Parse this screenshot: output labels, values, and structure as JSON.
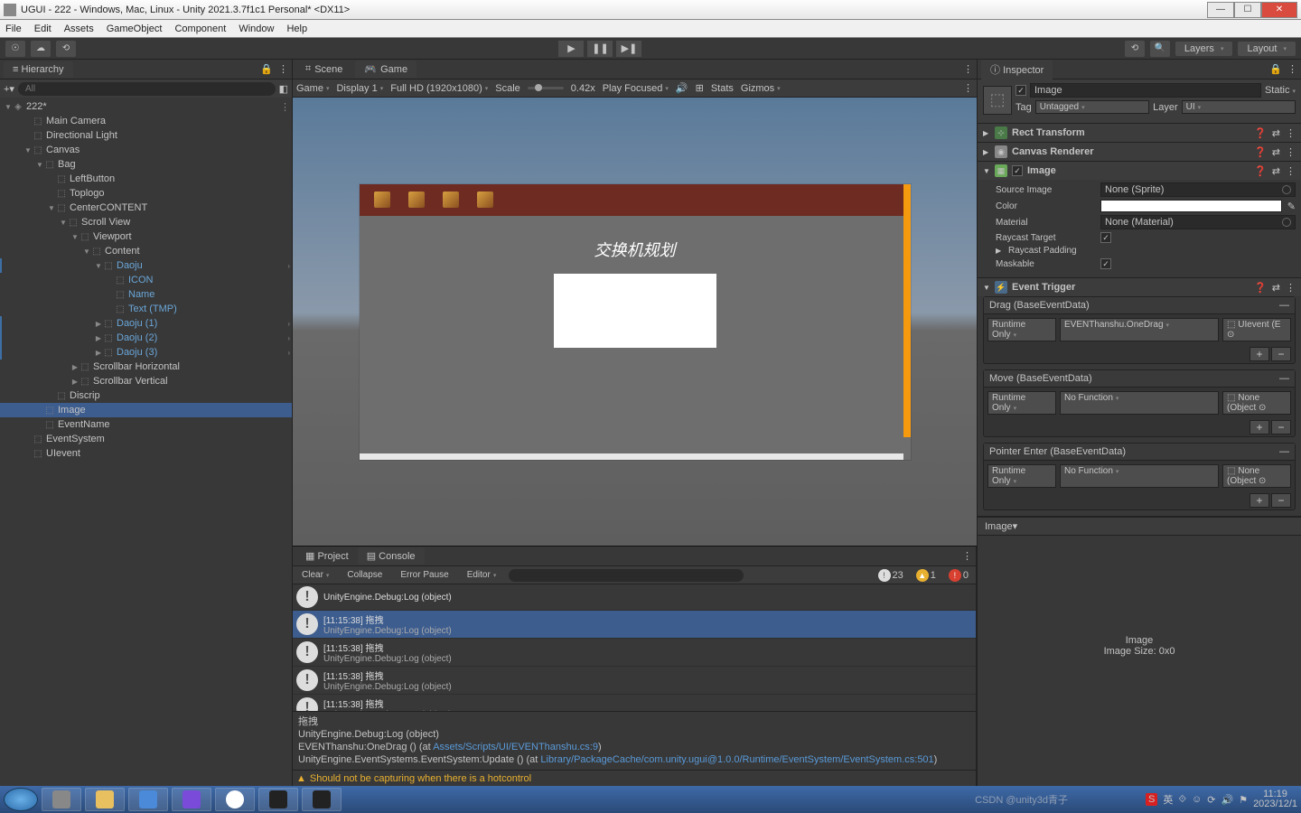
{
  "titlebar": {
    "text": "UGUI - 222 - Windows, Mac, Linux - Unity 2021.3.7f1c1 Personal* <DX11>"
  },
  "menubar": [
    "File",
    "Edit",
    "Assets",
    "GameObject",
    "Component",
    "Window",
    "Help"
  ],
  "toolbar": {
    "layers": "Layers",
    "layout": "Layout"
  },
  "hierarchy": {
    "title": "Hierarchy",
    "search_placeholder": "All",
    "root": "222*",
    "items": [
      {
        "label": "Main Camera",
        "indent": 2
      },
      {
        "label": "Directional Light",
        "indent": 2
      },
      {
        "label": "Canvas",
        "indent": 2,
        "arrow": "▼"
      },
      {
        "label": "Bag",
        "indent": 3,
        "arrow": "▼"
      },
      {
        "label": "LeftButton",
        "indent": 4
      },
      {
        "label": "Toplogo",
        "indent": 4
      },
      {
        "label": "CenterCONTENT",
        "indent": 4,
        "arrow": "▼"
      },
      {
        "label": "Scroll View",
        "indent": 5,
        "arrow": "▼"
      },
      {
        "label": "Viewport",
        "indent": 6,
        "arrow": "▼"
      },
      {
        "label": "Content",
        "indent": 7,
        "arrow": "▼"
      },
      {
        "label": "Daoju",
        "indent": 8,
        "arrow": "▼",
        "blue": true,
        "blueline": true,
        "more": true
      },
      {
        "label": "ICON",
        "indent": 9,
        "blue": true
      },
      {
        "label": "Name",
        "indent": 9,
        "blue": true
      },
      {
        "label": "Text (TMP)",
        "indent": 9,
        "blue": true
      },
      {
        "label": "Daoju (1)",
        "indent": 8,
        "arrow": "▶",
        "blue": true,
        "blueline": true,
        "more": true
      },
      {
        "label": "Daoju (2)",
        "indent": 8,
        "arrow": "▶",
        "blue": true,
        "blueline": true,
        "more": true
      },
      {
        "label": "Daoju (3)",
        "indent": 8,
        "arrow": "▶",
        "blue": true,
        "blueline": true,
        "more": true
      },
      {
        "label": "Scrollbar Horizontal",
        "indent": 6,
        "arrow": "▶"
      },
      {
        "label": "Scrollbar Vertical",
        "indent": 6,
        "arrow": "▶"
      },
      {
        "label": "Discrip",
        "indent": 4
      },
      {
        "label": "Image",
        "indent": 3,
        "selected": true
      },
      {
        "label": "EventName",
        "indent": 3
      },
      {
        "label": "EventSystem",
        "indent": 2
      },
      {
        "label": "UIevent",
        "indent": 2
      }
    ]
  },
  "viewtabs": {
    "scene": "Scene",
    "game": "Game"
  },
  "viewtoolbar": {
    "game": "Game",
    "display": "Display 1",
    "res": "Full HD (1920x1080)",
    "scale": "Scale",
    "scale_val": "0.42x",
    "play": "Play Focused",
    "stats": "Stats",
    "gizmos": "Gizmos"
  },
  "gameview": {
    "title": "交换机规划"
  },
  "inspector": {
    "title": "Inspector",
    "name": "Image",
    "static": "Static",
    "tag_label": "Tag",
    "tag": "Untagged",
    "layer_label": "Layer",
    "layer": "UI",
    "components": {
      "rect": "Rect Transform",
      "canvas": "Canvas Renderer",
      "image": "Image",
      "image_fields": {
        "source_image": "Source Image",
        "source_image_val": "None (Sprite)",
        "color": "Color",
        "material": "Material",
        "material_val": "None (Material)",
        "raycast": "Raycast Target",
        "raycast_pad": "Raycast Padding",
        "maskable": "Maskable"
      },
      "event_trigger": "Event Trigger",
      "events": [
        {
          "name": "Drag (BaseEventData)",
          "mode": "Runtime Only",
          "func": "EVENThanshu.OneDrag",
          "obj": "UIevent (E"
        },
        {
          "name": "Move (BaseEventData)",
          "mode": "Runtime Only",
          "func": "No Function",
          "obj": "None (Object"
        },
        {
          "name": "Pointer Enter (BaseEventData)",
          "mode": "Runtime Only",
          "func": "No Function",
          "obj": "None (Object"
        }
      ]
    },
    "footer_name": "Image",
    "footer_size": "Image Size: 0x0",
    "image_strip": "Image"
  },
  "bottom": {
    "project": "Project",
    "console": "Console",
    "toolbar": {
      "clear": "Clear",
      "collapse": "Collapse",
      "errpause": "Error Pause",
      "editor": "Editor"
    },
    "counts": {
      "info": "23",
      "warn": "1",
      "err": "0"
    },
    "logs": [
      {
        "line1": "UnityEngine.Debug:Log (object)",
        "line2": "",
        "single": true
      },
      {
        "line1": "[11:15:38] 拖拽",
        "line2": "UnityEngine.Debug:Log (object)",
        "sel": true
      },
      {
        "line1": "[11:15:38] 拖拽",
        "line2": "UnityEngine.Debug:Log (object)"
      },
      {
        "line1": "[11:15:38] 拖拽",
        "line2": "UnityEngine.Debug:Log (object)"
      },
      {
        "line1": "[11:15:38] 拖拽",
        "line2": "UnityEngine.Debug:Log (object)"
      }
    ],
    "detail": {
      "l1": "拖拽",
      "l2": "UnityEngine.Debug:Log (object)",
      "l3a": "EVENThanshu:OneDrag () (at ",
      "l3b": "Assets/Scripts/UI/EVENThanshu.cs:9",
      "l3c": ")",
      "l4a": "UnityEngine.EventSystems.EventSystem:Update () (at ",
      "l4b": "Library/PackageCache/com.unity.ugui@1.0.0/Runtime/EventSystem/EventSystem.cs:501",
      "l4c": ")"
    },
    "warn": "Should not be capturing when there is a hotcontrol"
  },
  "taskbar": {
    "watermark": "CSDN @unity3d青子",
    "time": "11:19",
    "date": "2023/12/1",
    "ime": "英"
  }
}
